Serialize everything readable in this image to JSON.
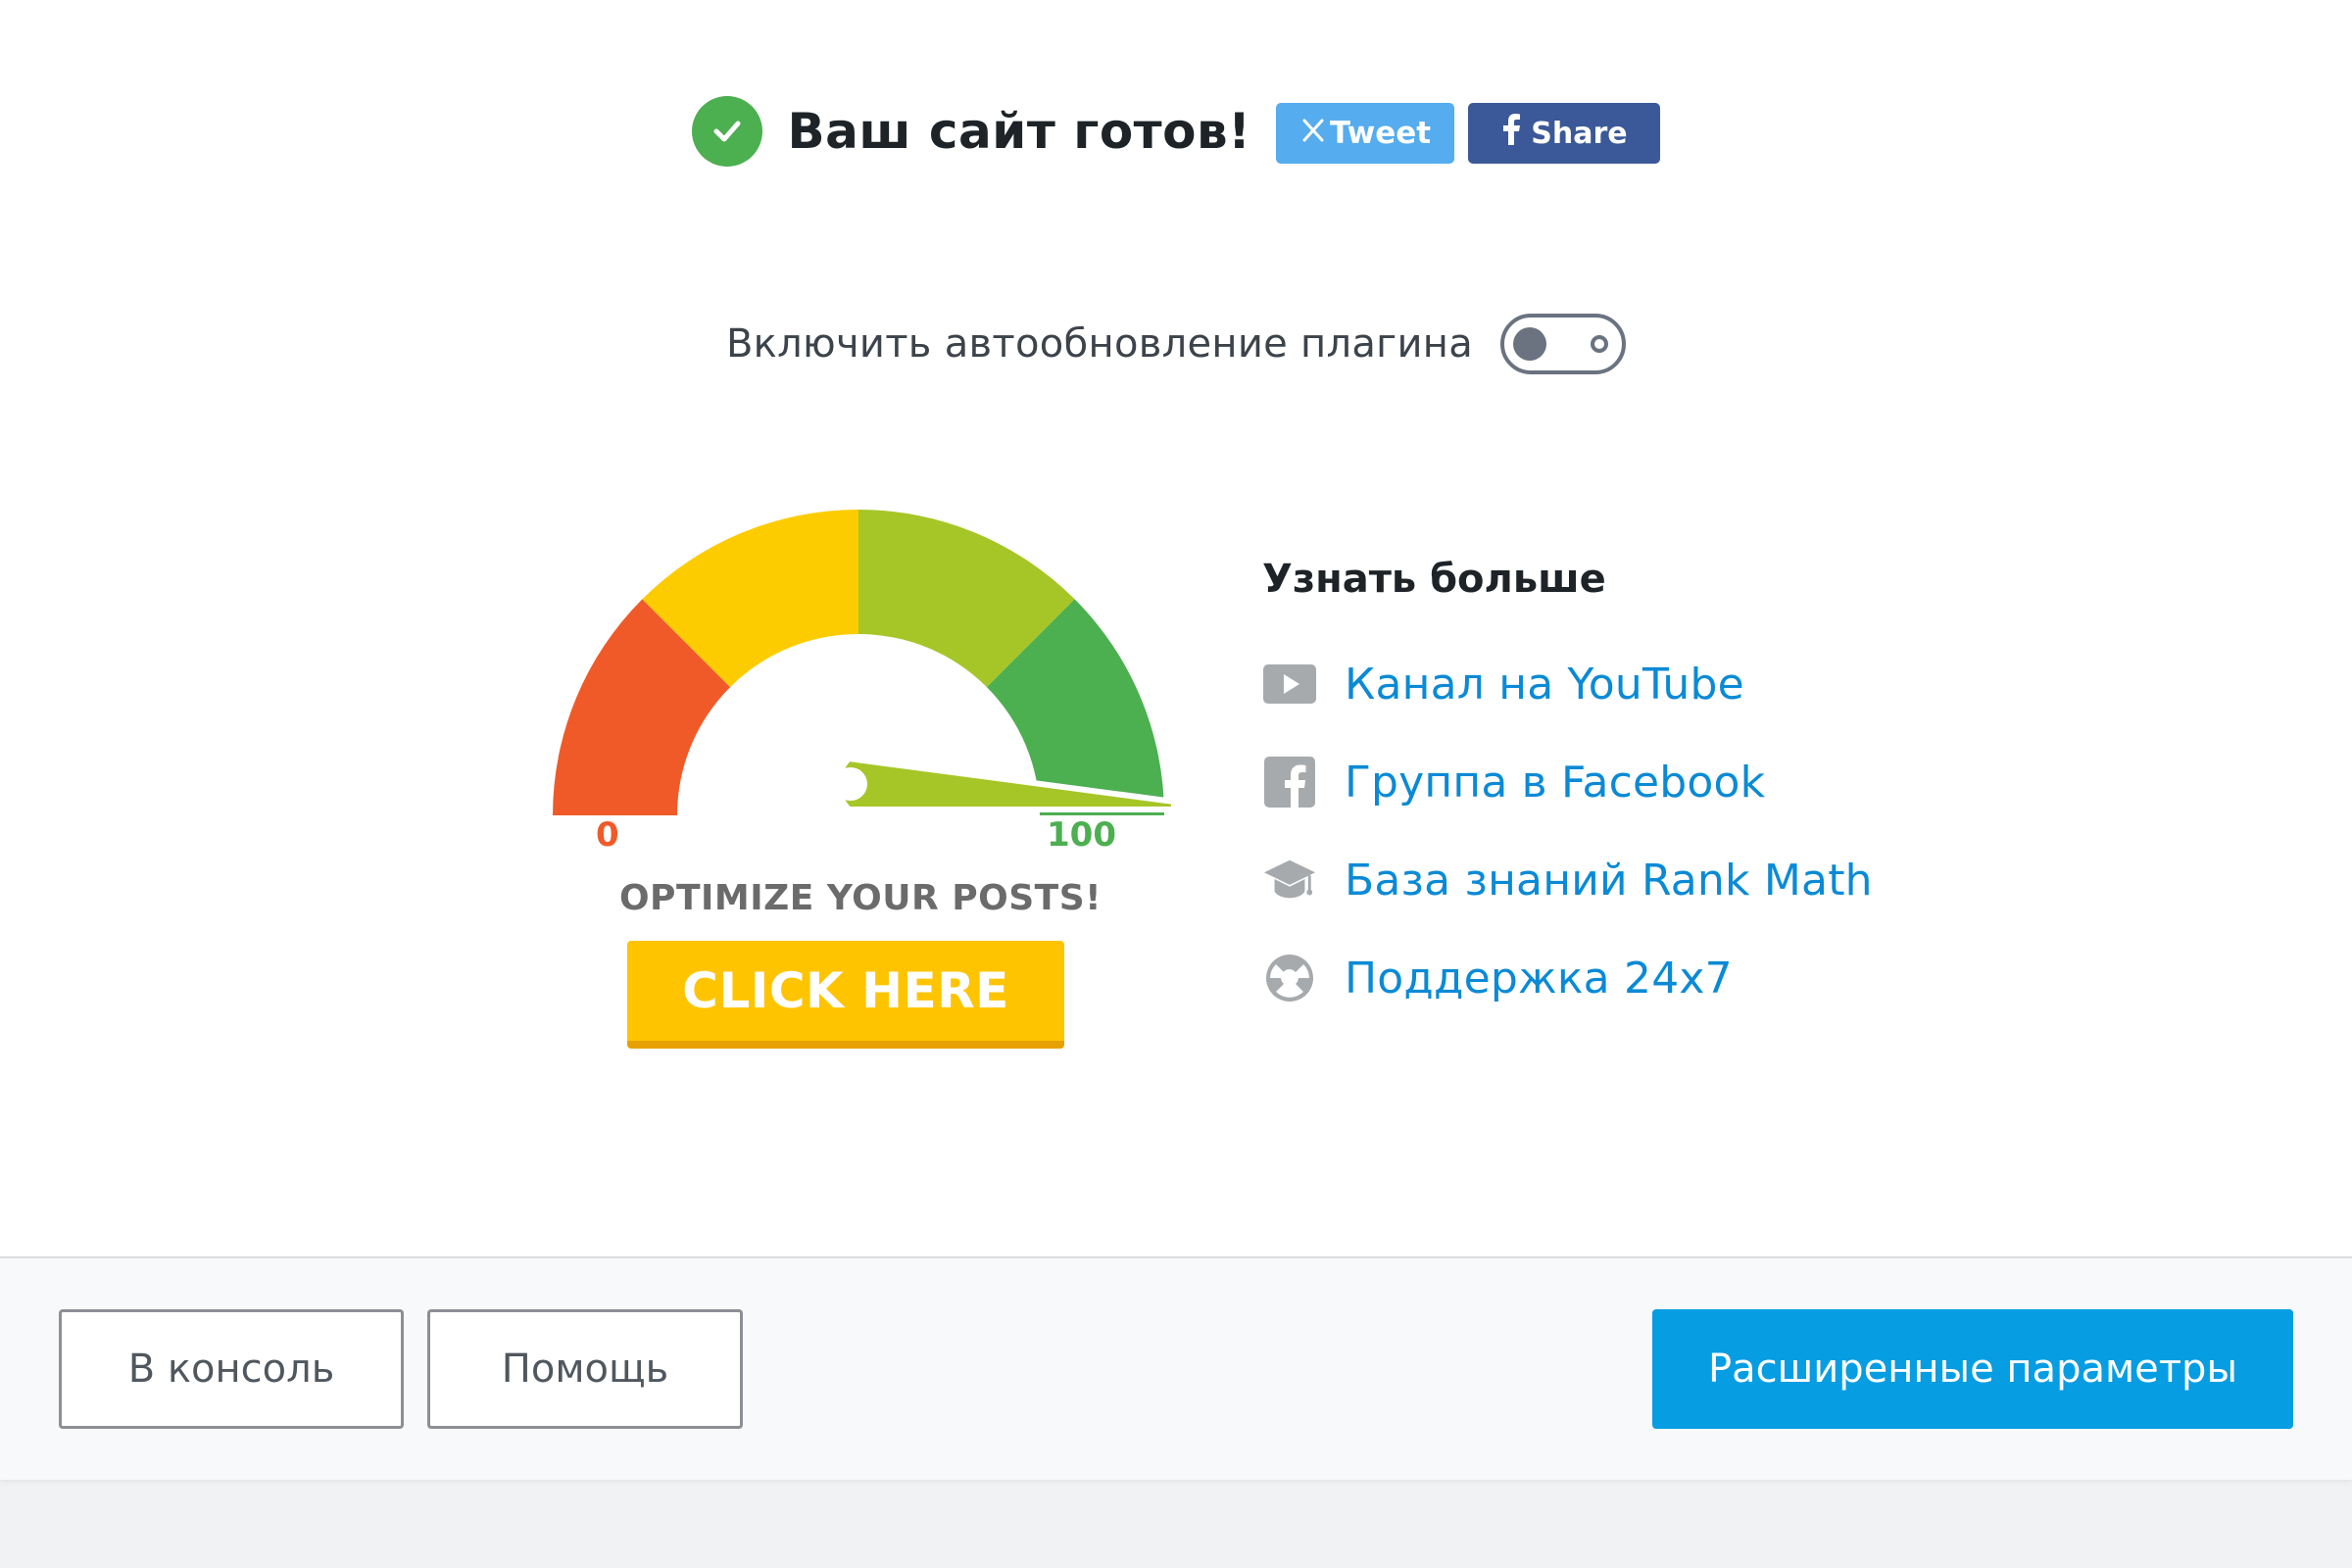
{
  "header": {
    "title": "Ваш сайт готов!",
    "tweet_label": "Tweet",
    "share_label": "Share"
  },
  "autoupdate": {
    "label": "Включить автообновление плагина",
    "enabled": false
  },
  "gauge": {
    "min_label": "0",
    "max_label": "100",
    "caption": "OPTIMIZE YOUR POSTS!",
    "cta_label": "CLICK HERE",
    "colors": [
      "#f05a28",
      "#fccc00",
      "#a6c628",
      "#4caf50"
    ]
  },
  "learn_more": {
    "title": "Узнать больше",
    "items": [
      {
        "label": "Канал на YouTube",
        "icon": "youtube-icon"
      },
      {
        "label": "Группа в Facebook",
        "icon": "facebook-icon"
      },
      {
        "label": "База знаний Rank Math",
        "icon": "graduation-cap-icon"
      },
      {
        "label": "Поддержка 24x7",
        "icon": "lifebuoy-icon"
      }
    ]
  },
  "footer": {
    "console_label": "В консоль",
    "help_label": "Помощь",
    "advanced_label": "Расширенные параметры"
  },
  "colors": {
    "accent": "#069de3",
    "link": "#0a8ad6",
    "success": "#4caf50",
    "twitter": "#55acee",
    "facebook": "#3b5998"
  }
}
